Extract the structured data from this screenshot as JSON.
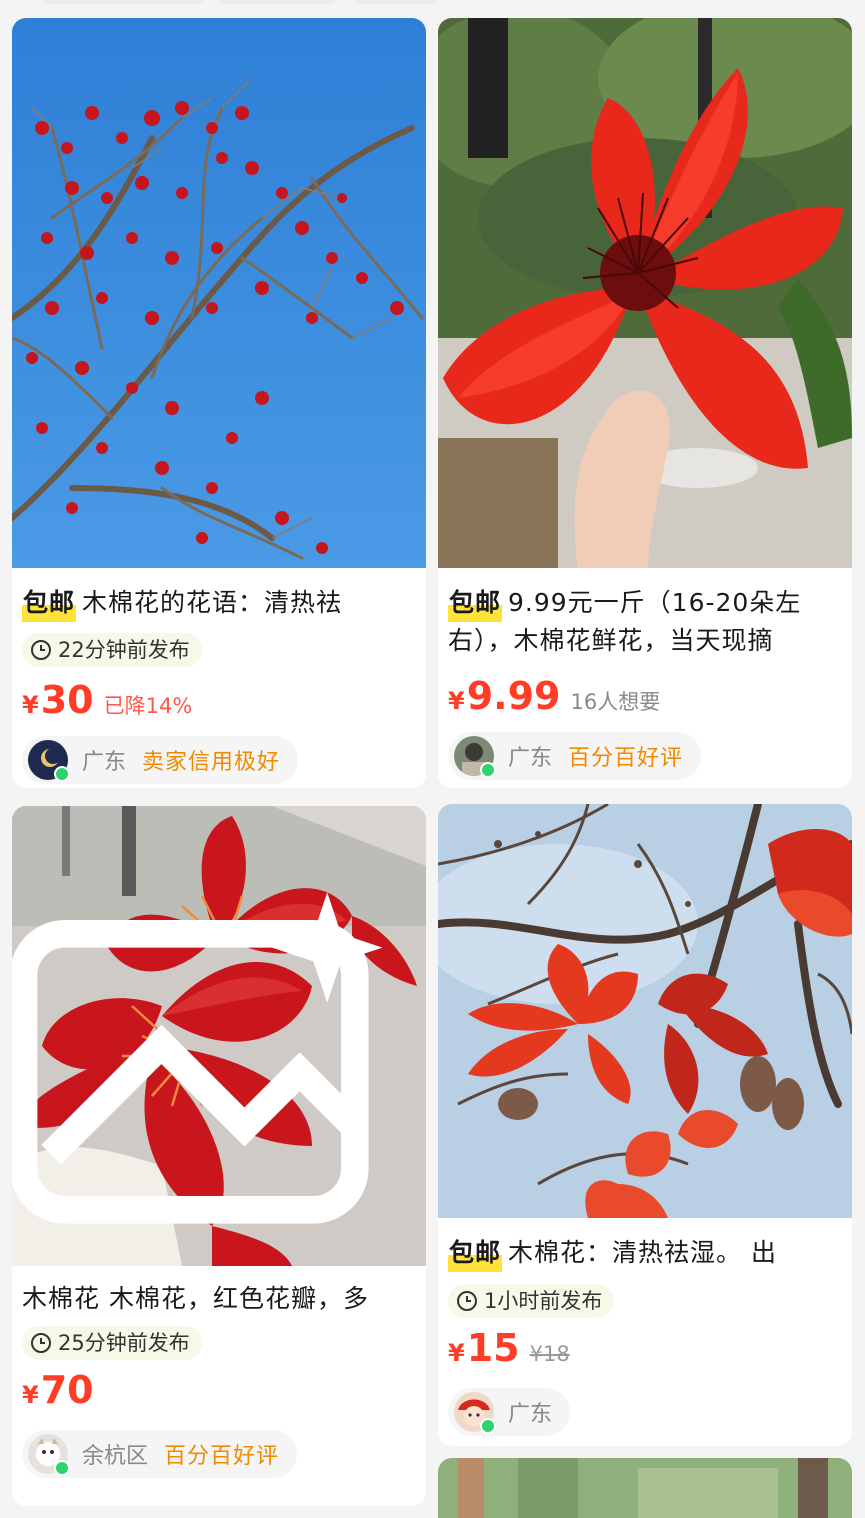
{
  "listings": [
    {
      "image": "bombax-tree-branches-against-blue-sky",
      "badge": "包邮",
      "title": "木棉花的花语：清热祛",
      "time": "22分钟前发布",
      "price_symbol": "¥",
      "price": "30",
      "price_note": "已降14%",
      "seller_location": "广东",
      "seller_tag": "卖家信用极好"
    },
    {
      "image": "hand-holding-red-kapok-flower",
      "badge": "包邮",
      "title": "9.99元一斤（16-20朵左右），木棉花鲜花，当天现摘",
      "price_symbol": "¥",
      "price": "9.99",
      "want_count": "16人想要",
      "seller_location": "广东",
      "seller_tag": "百分百好评"
    },
    {
      "image": "hand-holding-two-red-flowers",
      "title": "木棉花 木棉花，红色花瓣，多",
      "time": "25分钟前发布",
      "price_symbol": "¥",
      "price": "70",
      "seller_location": "余杭区",
      "seller_tag": "百分百好评"
    },
    {
      "image": "kapok-blossoms-on-branch",
      "badge": "包邮",
      "title": "木棉花：清热祛湿。 出",
      "time": "1小时前发布",
      "price_symbol": "¥",
      "price": "15",
      "original_price": "¥18",
      "seller_location": "广东"
    }
  ],
  "colors": {
    "price": "#ff3d26",
    "tag": "#f08a00",
    "badge_highlight": "#ffe33b",
    "online_dot": "#2dd36f"
  }
}
